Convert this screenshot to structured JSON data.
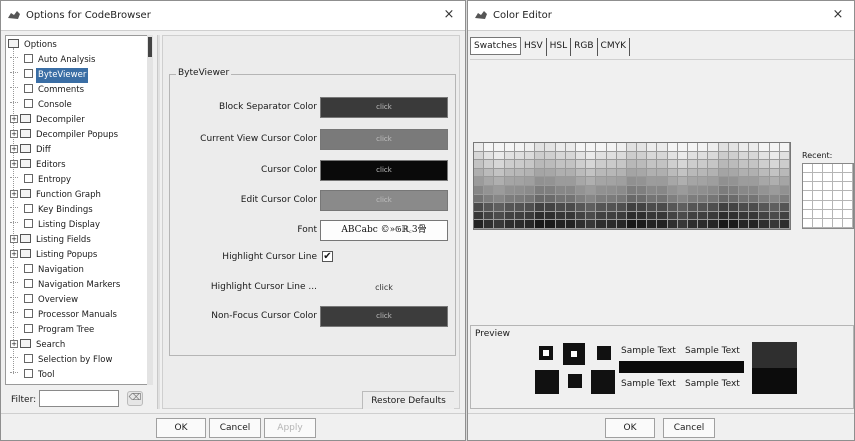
{
  "left_window": {
    "title": "Options for CodeBrowser",
    "close_glyph": "×",
    "tree": [
      {
        "label": "Options",
        "level": 0,
        "type": "folder-open",
        "expander": ""
      },
      {
        "label": "Auto Analysis",
        "level": 1,
        "type": "leaf"
      },
      {
        "label": "ByteViewer",
        "level": 1,
        "type": "leaf",
        "selected": true
      },
      {
        "label": "Comments",
        "level": 1,
        "type": "leaf"
      },
      {
        "label": "Console",
        "level": 1,
        "type": "leaf"
      },
      {
        "label": "Decompiler",
        "level": 1,
        "type": "folder",
        "expander": "+"
      },
      {
        "label": "Decompiler Popups",
        "level": 1,
        "type": "folder",
        "expander": "+"
      },
      {
        "label": "Diff",
        "level": 1,
        "type": "folder",
        "expander": "+"
      },
      {
        "label": "Editors",
        "level": 1,
        "type": "folder",
        "expander": "+"
      },
      {
        "label": "Entropy",
        "level": 1,
        "type": "leaf"
      },
      {
        "label": "Function Graph",
        "level": 1,
        "type": "folder",
        "expander": "+"
      },
      {
        "label": "Key Bindings",
        "level": 1,
        "type": "leaf"
      },
      {
        "label": "Listing Display",
        "level": 1,
        "type": "leaf"
      },
      {
        "label": "Listing Fields",
        "level": 1,
        "type": "folder",
        "expander": "+"
      },
      {
        "label": "Listing Popups",
        "level": 1,
        "type": "folder",
        "expander": "+"
      },
      {
        "label": "Navigation",
        "level": 1,
        "type": "leaf"
      },
      {
        "label": "Navigation Markers",
        "level": 1,
        "type": "leaf"
      },
      {
        "label": "Overview",
        "level": 1,
        "type": "leaf"
      },
      {
        "label": "Processor Manuals",
        "level": 1,
        "type": "leaf"
      },
      {
        "label": "Program Tree",
        "level": 1,
        "type": "leaf"
      },
      {
        "label": "Search",
        "level": 1,
        "type": "folder",
        "expander": "+"
      },
      {
        "label": "Selection by Flow",
        "level": 1,
        "type": "leaf"
      },
      {
        "label": "Tool",
        "level": 1,
        "type": "leaf"
      }
    ],
    "filter_label": "Filter:",
    "filter_value": "",
    "group_title": "ByteViewer",
    "options": [
      {
        "label": "Block Separator Color",
        "kind": "color",
        "color": "#3a3a3a",
        "text": "click"
      },
      {
        "label": "Current View Cursor Color",
        "kind": "color",
        "color": "#7a7a7a",
        "text": "click"
      },
      {
        "label": "Cursor Color",
        "kind": "color",
        "color": "#0a0a0a",
        "text": "click"
      },
      {
        "label": "Edit Cursor Color",
        "kind": "color",
        "color": "#8a8a8a",
        "text": "click"
      },
      {
        "label": "Font",
        "kind": "font",
        "text": "ABCabc ©»𝔊ℝ꜀3骨"
      },
      {
        "label": "Highlight Cursor Line",
        "kind": "checkbox",
        "checked": true,
        "text": "✔"
      },
      {
        "label": "Highlight Cursor Line ...",
        "kind": "plain",
        "text": "click"
      },
      {
        "label": "Non-Focus Cursor Color",
        "kind": "color",
        "color": "#3c3c3c",
        "text": "click"
      }
    ],
    "restore_defaults": "Restore Defaults",
    "buttons": {
      "ok": "OK",
      "cancel": "Cancel",
      "apply": "Apply"
    }
  },
  "right_window": {
    "title": "Color Editor",
    "close_glyph": "×",
    "tabs": [
      "Swatches",
      "HSV",
      "HSL",
      "RGB",
      "CMYK"
    ],
    "recent_label": "Recent:",
    "preview_title": "Preview",
    "sample_text": "Sample Text",
    "preview_color": "#2f2f2f",
    "buttons": {
      "ok": "OK",
      "cancel": "Cancel"
    }
  }
}
